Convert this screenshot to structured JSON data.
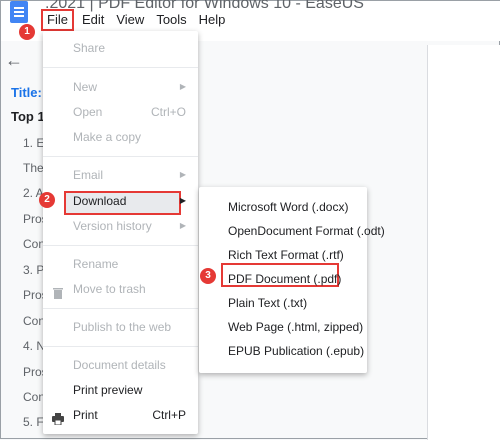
{
  "app": {
    "title_fragment": ".2021 | PDF Editor for Windows 10 - EaseUS"
  },
  "menubar": {
    "file": "File",
    "edit": "Edit",
    "view": "View",
    "tools": "Tools",
    "help": "Help"
  },
  "markers": {
    "one": "1",
    "two": "2",
    "three": "3"
  },
  "outline": {
    "title": "Title:",
    "heading": "Top 1",
    "items": [
      "1. E",
      "The",
      "2. A",
      "Pros",
      "Con",
      "3. P",
      "Pros",
      "Con",
      "4. N",
      "Pros",
      "Con",
      "5. F"
    ]
  },
  "file_menu": {
    "share": "Share",
    "new": "New",
    "open": "Open",
    "open_shortcut": "Ctrl+O",
    "make_copy": "Make a copy",
    "email": "Email",
    "download": "Download",
    "version_history": "Version history",
    "rename": "Rename",
    "move_to_trash": "Move to trash",
    "publish": "Publish to the web",
    "document_details": "Document details",
    "print_preview": "Print preview",
    "print": "Print",
    "print_shortcut": "Ctrl+P"
  },
  "download_menu": {
    "items": [
      "Microsoft Word (.docx)",
      "OpenDocument Format (.odt)",
      "Rich Text Format (.rtf)",
      "PDF Document (.pdf)",
      "Plain Text (.txt)",
      "Web Page (.html, zipped)",
      "EPUB Publication (.epub)"
    ]
  },
  "colors": {
    "accent": "#1a73e8",
    "highlight": "#e53935",
    "logo": "#4285f4"
  }
}
